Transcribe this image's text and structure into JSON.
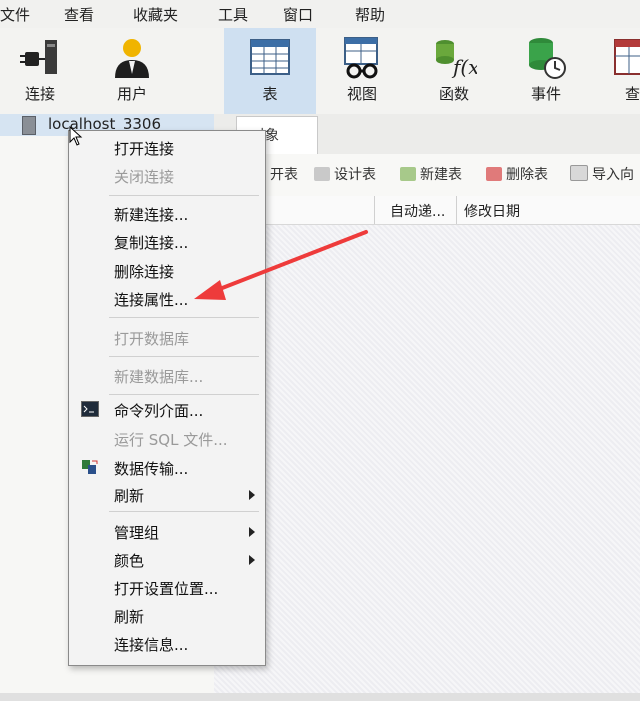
{
  "menubar": {
    "items": [
      "文件",
      "查看",
      "收藏夹",
      "工具",
      "窗口",
      "帮助"
    ]
  },
  "toolbar": {
    "buttons": [
      {
        "label": "连接",
        "icon": "plug-icon"
      },
      {
        "label": "用户",
        "icon": "user-icon"
      },
      {
        "label": "表",
        "icon": "table-icon",
        "active": true
      },
      {
        "label": "视图",
        "icon": "view-icon"
      },
      {
        "label": "函数",
        "icon": "function-icon"
      },
      {
        "label": "事件",
        "icon": "event-icon"
      },
      {
        "label": "查询",
        "icon": "query-icon"
      }
    ]
  },
  "tree": {
    "connection": "localhost_3306"
  },
  "tabs": {
    "objects": "对象"
  },
  "object_toolbar": {
    "open_table": "开表",
    "design_table": "设计表",
    "new_table": "新建表",
    "delete_table": "删除表",
    "import_wizard": "导入向"
  },
  "table_header": {
    "col_autoinc": "自动递...",
    "col_modified": "修改日期"
  },
  "context_menu": {
    "items": [
      {
        "label": "打开连接",
        "enabled": true
      },
      {
        "label": "关闭连接",
        "enabled": false
      },
      {
        "label": "新建连接...",
        "enabled": true
      },
      {
        "label": "复制连接...",
        "enabled": true
      },
      {
        "label": "删除连接",
        "enabled": true
      },
      {
        "label": "连接属性...",
        "enabled": true
      },
      {
        "label": "打开数据库",
        "enabled": false
      },
      {
        "label": "新建数据库...",
        "enabled": false
      },
      {
        "label": "命令列介面...",
        "enabled": true
      },
      {
        "label": "运行 SQL 文件...",
        "enabled": false
      },
      {
        "label": "数据传输...",
        "enabled": true
      },
      {
        "label": "刷新",
        "enabled": true,
        "submenu": true
      },
      {
        "label": "管理组",
        "enabled": true,
        "submenu": true
      },
      {
        "label": "颜色",
        "enabled": true,
        "submenu": true
      },
      {
        "label": "打开设置位置...",
        "enabled": true
      },
      {
        "label": "刷新",
        "enabled": true
      },
      {
        "label": "连接信息...",
        "enabled": true
      }
    ]
  },
  "colors": {
    "accent_active": "#cfe0f1",
    "annotation_arrow": "#ee3b3b"
  }
}
